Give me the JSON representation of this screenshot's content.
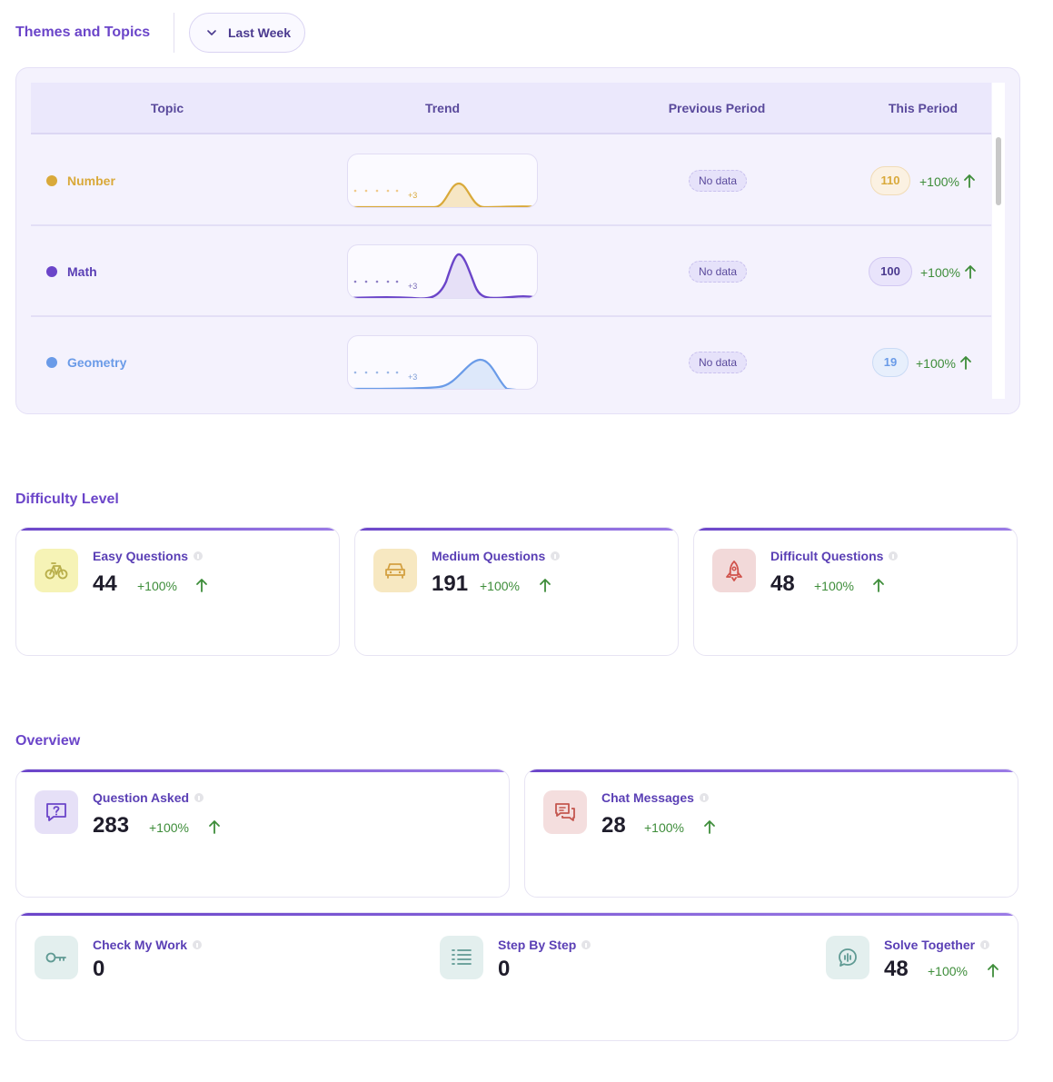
{
  "header": {
    "title": "Themes and Topics",
    "period_label": "Last Week"
  },
  "topics_table": {
    "columns": [
      "Topic",
      "Trend",
      "Previous Period",
      "This Period"
    ],
    "rows": [
      {
        "name": "Number",
        "color": "#d9a93a",
        "trend_note": "+3",
        "previous": "No data",
        "count": "110",
        "change": "+100%"
      },
      {
        "name": "Math",
        "color": "#6b45c9",
        "trend_note": "+3",
        "previous": "No data",
        "count": "100",
        "change": "+100%"
      },
      {
        "name": "Geometry",
        "color": "#6a9be8",
        "trend_note": "+3",
        "previous": "No data",
        "count": "19",
        "change": "+100%"
      }
    ]
  },
  "difficulty": {
    "title": "Difficulty Level",
    "cards": [
      {
        "label": "Easy Questions",
        "value": "44",
        "change": "+100%",
        "icon": "bicycle-icon",
        "icon_bg": "#f6f3b6",
        "icon_color": "#b8ae4a"
      },
      {
        "label": "Medium Questions",
        "value": "191",
        "change": "+100%",
        "icon": "car-icon",
        "icon_bg": "#f7e8c1",
        "icon_color": "#d3a041"
      },
      {
        "label": "Difficult Questions",
        "value": "48",
        "change": "+100%",
        "icon": "rocket-icon",
        "icon_bg": "#f2d9d9",
        "icon_color": "#d0524b"
      }
    ]
  },
  "overview": {
    "title": "Overview",
    "cards": [
      {
        "label": "Question Asked",
        "value": "283",
        "change": "+100%",
        "icon": "question-bubble-icon",
        "icon_bg": "#e6e0f7",
        "icon_color": "#6b45c9"
      },
      {
        "label": "Chat Messages",
        "value": "28",
        "change": "+100%",
        "icon": "chat-bubbles-icon",
        "icon_bg": "#f4dede",
        "icon_color": "#c4574f"
      }
    ],
    "modes": [
      {
        "label": "Check My Work",
        "value": "0",
        "change": "",
        "icon": "key-icon",
        "icon_bg": "#e3efee",
        "icon_color": "#5f9a93"
      },
      {
        "label": "Step By Step",
        "value": "0",
        "change": "",
        "icon": "list-icon",
        "icon_bg": "#e3efee",
        "icon_color": "#5f9a93"
      },
      {
        "label": "Solve Together",
        "value": "48",
        "change": "+100%",
        "icon": "voice-bubble-icon",
        "icon_bg": "#e3efee",
        "icon_color": "#5f9a93"
      }
    ]
  }
}
